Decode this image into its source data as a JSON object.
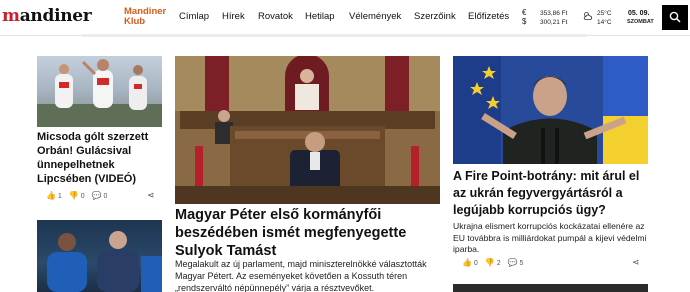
{
  "header": {
    "logo_prefix": "m",
    "logo_rest": "andiner",
    "club_line1": "Mandiner",
    "club_line2": "Klub",
    "nav": [
      "Címlap",
      "Hírek",
      "Rovatok",
      "Hetilap",
      "Vélemények",
      "Szerzőink",
      "Előfizetés"
    ],
    "currency": [
      {
        "symbol": "€",
        "value": "353,86 Ft"
      },
      {
        "symbol": "$",
        "value": "300,21 Ft"
      }
    ],
    "weather": {
      "high": "25°C",
      "low": "14°C",
      "icon": "cloud-sun-icon"
    },
    "date": "05. 09.",
    "weekday": "SZOMBAT",
    "search_icon": "search-icon"
  },
  "articles": {
    "left_top": {
      "title": "Micsoda gólt szerzett Orbán! Gulácsival ünnepelhetnek Lipcsében (VIDEÓ)",
      "likes": "1",
      "dislikes": "0",
      "comments": "0"
    },
    "center": {
      "title": "Magyar Péter első kormányfői beszédében ismét megfenyegette Sulyok Tamást",
      "lead": "Megalakult az új parlament, majd miniszterelnökké választották Magyar Pétert. Az eseményeket követően a Kossuth téren „rendszerváltó népünnepély” várja a résztvevőket."
    },
    "right": {
      "title": "A Fire Point-botrány: mit árul el az ukrán fegyvergyártásról a legújabb korrupciós ügy?",
      "lead": "Ukrajna elismert korrupciós kockázatai ellenére az EU továbbra is milliárdokat pumpál a kijevi védelmi iparba.",
      "likes": "0",
      "dislikes": "2",
      "comments": "5"
    }
  },
  "colors": {
    "accent": "#d35d1b",
    "logo_red": "#c8202f"
  }
}
